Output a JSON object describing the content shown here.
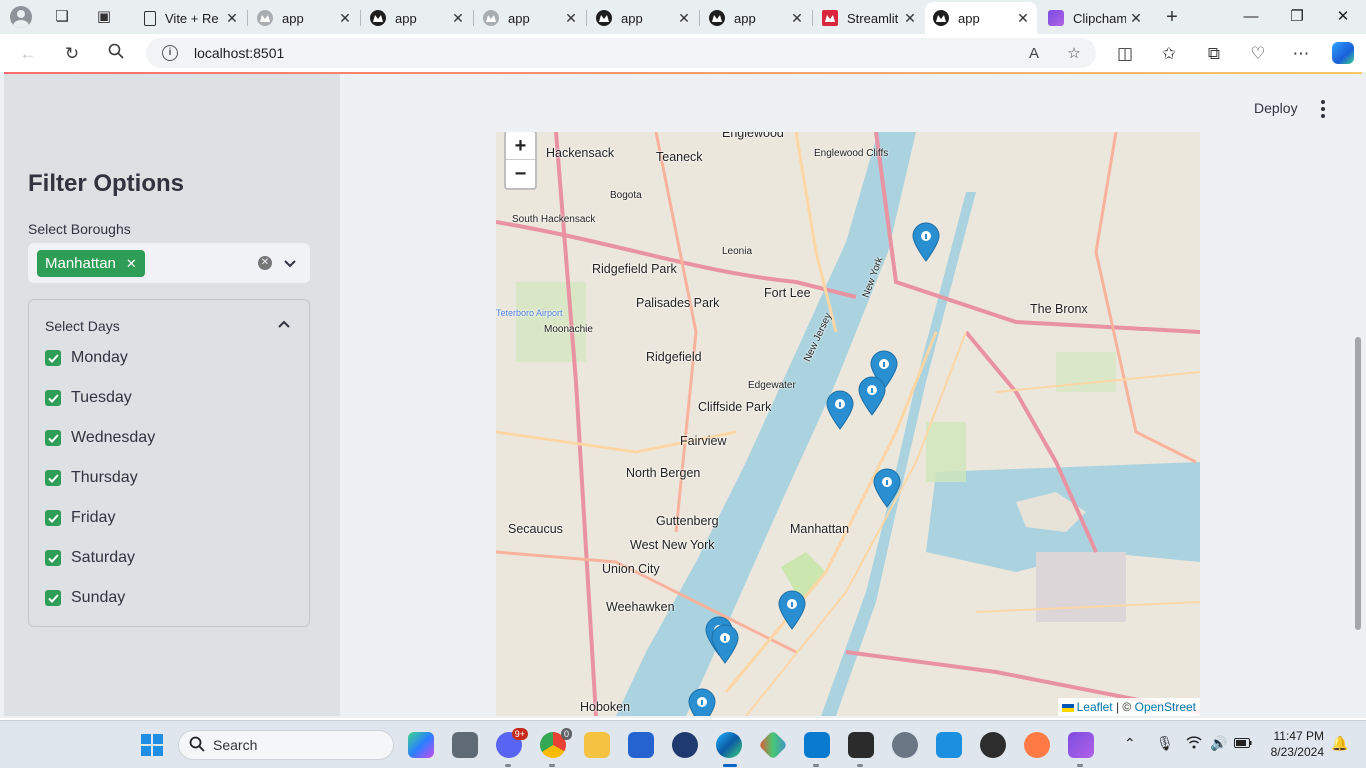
{
  "browser": {
    "tabs": [
      {
        "title": "Vite + Re",
        "icon": "document-icon"
      },
      {
        "title": "app",
        "icon": "streamlit-icon"
      },
      {
        "title": "app",
        "icon": "streamlit-icon"
      },
      {
        "title": "app",
        "icon": "streamlit-icon"
      },
      {
        "title": "app",
        "icon": "streamlit-icon"
      },
      {
        "title": "app",
        "icon": "streamlit-icon"
      },
      {
        "title": "Streamlit",
        "icon": "streamlit-crown-icon"
      },
      {
        "title": "app",
        "icon": "streamlit-icon",
        "active": true
      },
      {
        "title": "Clipchamp",
        "icon": "clipchamp-icon"
      }
    ],
    "url": "localhost:8501"
  },
  "sidebar": {
    "title": "Filter Options",
    "boroughs_label": "Select Boroughs",
    "selected_borough": "Manhattan",
    "days_label": "Select Days",
    "days": [
      "Monday",
      "Tuesday",
      "Wednesday",
      "Thursday",
      "Friday",
      "Saturday",
      "Sunday"
    ]
  },
  "header": {
    "deploy_label": "Deploy"
  },
  "map": {
    "zoom_in": "+",
    "zoom_out": "−",
    "attribution_leaflet": "Leaflet",
    "attribution_sep": "| ©",
    "attribution_osm": "OpenStreet",
    "labels": [
      "Englewood",
      "Hackensack",
      "Teaneck",
      "Englewood Cliffs",
      "Bogota",
      "South Hackensack",
      "Leonia",
      "Ridgefield Park",
      "Palisades Park",
      "Fort Lee",
      "Teterboro Airport",
      "Moonachie",
      "Ridgefield",
      "Edgewater",
      "Cliffside Park",
      "Fairview",
      "North Bergen",
      "Guttenberg",
      "Manhattan",
      "West New York",
      "Secaucus",
      "Union City",
      "Weehawken",
      "Hoboken",
      "The Bronx",
      "New York",
      "New Jersey"
    ],
    "accent": "#2a8fd1"
  },
  "taskbar": {
    "search_placeholder": "Search",
    "discord_badge": "9+",
    "chrome_badge": "0",
    "time": "11:47 PM",
    "date": "8/23/2024"
  }
}
